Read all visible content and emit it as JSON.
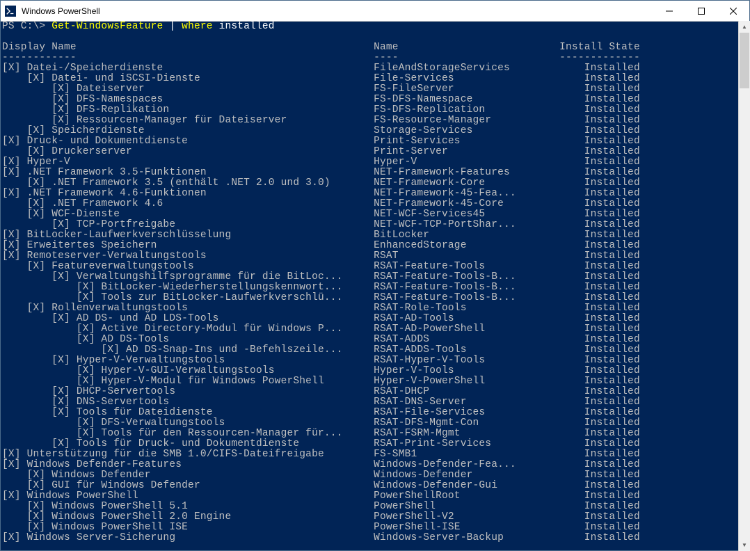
{
  "window": {
    "title": "Windows PowerShell"
  },
  "prompt": {
    "prefix": "PS C:\\> ",
    "cmd1": "Get-WindowsFeature",
    "pipe": " | ",
    "cmd2": "where",
    "arg": " installed"
  },
  "headers": {
    "display": "Display Name",
    "name": "Name",
    "state": "Install State",
    "underline_display": "------------",
    "underline_name": "----",
    "underline_state": "-------------"
  },
  "rows": [
    {
      "indent": 0,
      "display": "Datei-/Speicherdienste",
      "name": "FileAndStorageServices",
      "state": "Installed"
    },
    {
      "indent": 1,
      "display": "Datei- und iSCSI-Dienste",
      "name": "File-Services",
      "state": "Installed"
    },
    {
      "indent": 2,
      "display": "Dateiserver",
      "name": "FS-FileServer",
      "state": "Installed"
    },
    {
      "indent": 2,
      "display": "DFS-Namespaces",
      "name": "FS-DFS-Namespace",
      "state": "Installed"
    },
    {
      "indent": 2,
      "display": "DFS-Replikation",
      "name": "FS-DFS-Replication",
      "state": "Installed"
    },
    {
      "indent": 2,
      "display": "Ressourcen-Manager für Dateiserver",
      "name": "FS-Resource-Manager",
      "state": "Installed"
    },
    {
      "indent": 1,
      "display": "Speicherdienste",
      "name": "Storage-Services",
      "state": "Installed"
    },
    {
      "indent": 0,
      "display": "Druck- und Dokumentdienste",
      "name": "Print-Services",
      "state": "Installed"
    },
    {
      "indent": 1,
      "display": "Druckerserver",
      "name": "Print-Server",
      "state": "Installed"
    },
    {
      "indent": 0,
      "display": "Hyper-V",
      "name": "Hyper-V",
      "state": "Installed"
    },
    {
      "indent": 0,
      "display": ".NET Framework 3.5-Funktionen",
      "name": "NET-Framework-Features",
      "state": "Installed"
    },
    {
      "indent": 1,
      "display": ".NET Framework 3.5 (enthält .NET 2.0 und 3.0)",
      "name": "NET-Framework-Core",
      "state": "Installed"
    },
    {
      "indent": 0,
      "display": ".NET Framework 4.6-Funktionen",
      "name": "NET-Framework-45-Fea...",
      "state": "Installed"
    },
    {
      "indent": 1,
      "display": ".NET Framework 4.6",
      "name": "NET-Framework-45-Core",
      "state": "Installed"
    },
    {
      "indent": 1,
      "display": "WCF-Dienste",
      "name": "NET-WCF-Services45",
      "state": "Installed"
    },
    {
      "indent": 2,
      "display": "TCP-Portfreigabe",
      "name": "NET-WCF-TCP-PortShar...",
      "state": "Installed"
    },
    {
      "indent": 0,
      "display": "BitLocker-Laufwerkverschlüsselung",
      "name": "BitLocker",
      "state": "Installed"
    },
    {
      "indent": 0,
      "display": "Erweitertes Speichern",
      "name": "EnhancedStorage",
      "state": "Installed"
    },
    {
      "indent": 0,
      "display": "Remoteserver-Verwaltungstools",
      "name": "RSAT",
      "state": "Installed"
    },
    {
      "indent": 1,
      "display": "Featureverwaltungstools",
      "name": "RSAT-Feature-Tools",
      "state": "Installed"
    },
    {
      "indent": 2,
      "display": "Verwaltungshilfsprogramme für die BitLoc...",
      "name": "RSAT-Feature-Tools-B...",
      "state": "Installed"
    },
    {
      "indent": 3,
      "display": "BitLocker-Wiederherstellungskennwort...",
      "name": "RSAT-Feature-Tools-B...",
      "state": "Installed"
    },
    {
      "indent": 3,
      "display": "Tools zur BitLocker-Laufwerkverschlü...",
      "name": "RSAT-Feature-Tools-B...",
      "state": "Installed"
    },
    {
      "indent": 1,
      "display": "Rollenverwaltungstools",
      "name": "RSAT-Role-Tools",
      "state": "Installed"
    },
    {
      "indent": 2,
      "display": "AD DS- und AD LDS-Tools",
      "name": "RSAT-AD-Tools",
      "state": "Installed"
    },
    {
      "indent": 3,
      "display": "Active Directory-Modul für Windows P...",
      "name": "RSAT-AD-PowerShell",
      "state": "Installed"
    },
    {
      "indent": 3,
      "display": "AD DS-Tools",
      "name": "RSAT-ADDS",
      "state": "Installed"
    },
    {
      "indent": 4,
      "display": "AD DS-Snap-Ins und -Befehlszeile...",
      "name": "RSAT-ADDS-Tools",
      "state": "Installed"
    },
    {
      "indent": 2,
      "display": "Hyper-V-Verwaltungstools",
      "name": "RSAT-Hyper-V-Tools",
      "state": "Installed"
    },
    {
      "indent": 3,
      "display": "Hyper-V-GUI-Verwaltungstools",
      "name": "Hyper-V-Tools",
      "state": "Installed"
    },
    {
      "indent": 3,
      "display": "Hyper-V-Modul für Windows PowerShell",
      "name": "Hyper-V-PowerShell",
      "state": "Installed"
    },
    {
      "indent": 2,
      "display": "DHCP-Servertools",
      "name": "RSAT-DHCP",
      "state": "Installed"
    },
    {
      "indent": 2,
      "display": "DNS-Servertools",
      "name": "RSAT-DNS-Server",
      "state": "Installed"
    },
    {
      "indent": 2,
      "display": "Tools für Dateidienste",
      "name": "RSAT-File-Services",
      "state": "Installed"
    },
    {
      "indent": 3,
      "display": "DFS-Verwaltungstools",
      "name": "RSAT-DFS-Mgmt-Con",
      "state": "Installed"
    },
    {
      "indent": 3,
      "display": "Tools für den Ressourcen-Manager für...",
      "name": "RSAT-FSRM-Mgmt",
      "state": "Installed"
    },
    {
      "indent": 2,
      "display": "Tools für Druck- und Dokumentdienste",
      "name": "RSAT-Print-Services",
      "state": "Installed"
    },
    {
      "indent": 0,
      "display": "Unterstützung für die SMB 1.0/CIFS-Dateifreigabe",
      "name": "FS-SMB1",
      "state": "Installed"
    },
    {
      "indent": 0,
      "display": "Windows Defender-Features",
      "name": "Windows-Defender-Fea...",
      "state": "Installed"
    },
    {
      "indent": 1,
      "display": "Windows Defender",
      "name": "Windows-Defender",
      "state": "Installed"
    },
    {
      "indent": 1,
      "display": "GUI für Windows Defender",
      "name": "Windows-Defender-Gui",
      "state": "Installed"
    },
    {
      "indent": 0,
      "display": "Windows PowerShell",
      "name": "PowerShellRoot",
      "state": "Installed"
    },
    {
      "indent": 1,
      "display": "Windows PowerShell 5.1",
      "name": "PowerShell",
      "state": "Installed"
    },
    {
      "indent": 1,
      "display": "Windows PowerShell 2.0 Engine",
      "name": "PowerShell-V2",
      "state": "Installed"
    },
    {
      "indent": 1,
      "display": "Windows PowerShell ISE",
      "name": "PowerShell-ISE",
      "state": "Installed"
    },
    {
      "indent": 0,
      "display": "Windows Server-Sicherung",
      "name": "Windows-Server-Backup",
      "state": "Installed"
    }
  ]
}
